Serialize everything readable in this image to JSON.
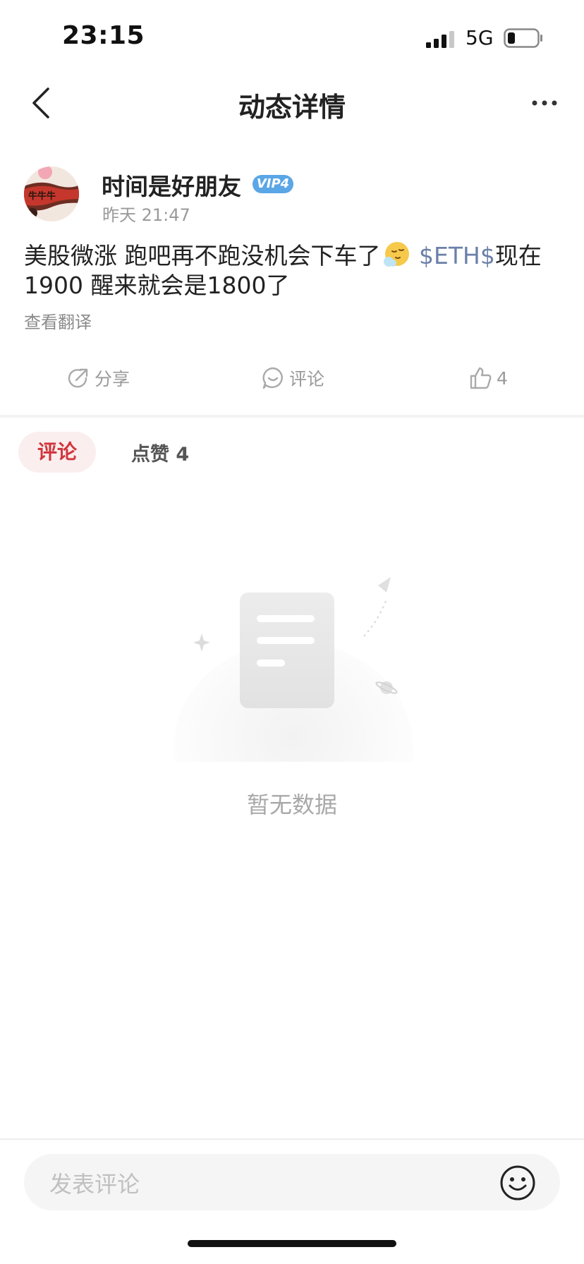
{
  "status_bar": {
    "time": "23:15",
    "network": "5G",
    "signal_icon": "signal-icon",
    "battery_icon": "battery-icon"
  },
  "nav": {
    "title": "动态详情",
    "back_icon": "chevron-left-icon",
    "more_icon": "more-horizontal-icon"
  },
  "post": {
    "author": "时间是好朋友",
    "vip_badge": "VIP4",
    "timestamp": "昨天 21:47",
    "text_part1": "美股微涨 跑吧再不跑没机会下车了",
    "emoji": "sleepy-face-emoji",
    "ticker": "$ETH$",
    "text_part2": "现在1900 醒来就会是1800了",
    "translate_label": "查看翻译"
  },
  "actions": {
    "share_label": "分享",
    "comment_label": "评论",
    "like_count": "4"
  },
  "tabs": {
    "comments": "评论",
    "likes": "点赞 4"
  },
  "empty_state": {
    "text": "暂无数据",
    "illustration": "document-illustration"
  },
  "comment_input": {
    "placeholder": "发表评论",
    "emoji_icon": "smiley-icon"
  },
  "colors": {
    "accent_red": "#d0373f",
    "ticker_blue": "#6b80a8",
    "vip_blue": "#5aa6e6"
  }
}
